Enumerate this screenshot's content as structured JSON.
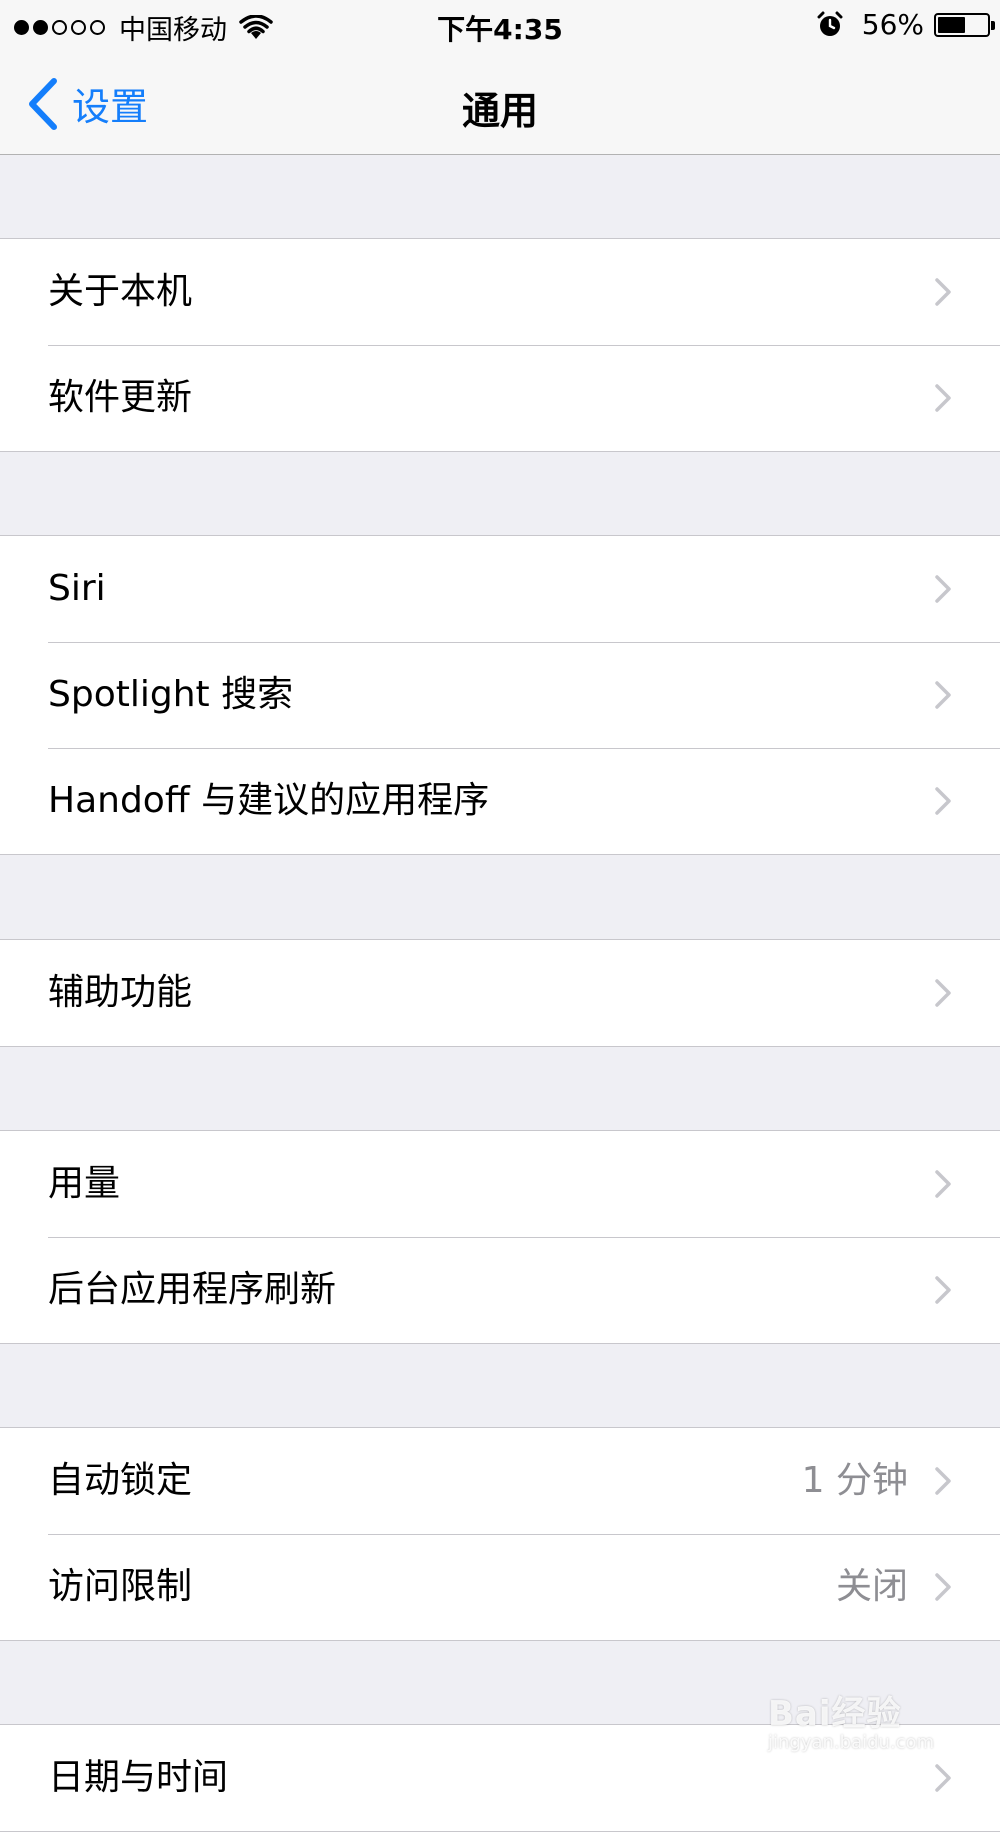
{
  "status_bar": {
    "carrier": "中国移动",
    "time": "下午4:35",
    "battery_percent": "56%",
    "battery_level": 0.56,
    "signal_bars_filled": 2,
    "signal_bars_total": 5,
    "icons": [
      "signal-dots-icon",
      "wifi-icon",
      "alarm-icon",
      "battery-icon"
    ]
  },
  "nav": {
    "back_label": "设置",
    "title": "通用",
    "back_icon": "chevron-left-icon",
    "accent_color": "#147efb"
  },
  "groups": [
    {
      "items": [
        {
          "label": "关于本机"
        },
        {
          "label": "软件更新"
        }
      ]
    },
    {
      "items": [
        {
          "label": "Siri"
        },
        {
          "label": "Spotlight 搜索"
        },
        {
          "label": "Handoff 与建议的应用程序"
        }
      ]
    },
    {
      "items": [
        {
          "label": "辅助功能"
        }
      ]
    },
    {
      "items": [
        {
          "label": "用量"
        },
        {
          "label": "后台应用程序刷新"
        }
      ]
    },
    {
      "items": [
        {
          "label": "自动锁定",
          "value": "1 分钟"
        },
        {
          "label": "访问限制",
          "value": "关闭"
        }
      ]
    },
    {
      "items": [
        {
          "label": "日期与时间"
        }
      ]
    }
  ],
  "watermark": {
    "brand": "Bai经验",
    "site": "jingyan.baidu.com"
  },
  "colors": {
    "background": "#efeff4",
    "separator": "#c8c7cc",
    "chevron": "#c7c7cc",
    "secondary_text": "#8e8e93"
  }
}
